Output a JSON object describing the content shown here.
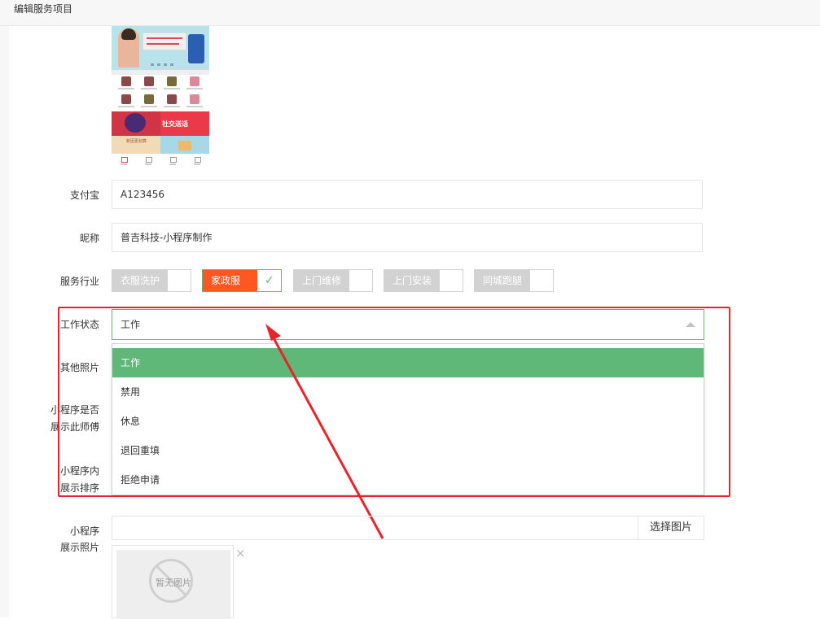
{
  "header": {
    "title": "编辑服务项目"
  },
  "preview": {
    "promo_text": "社交送话",
    "promo_sub": "新团更划算"
  },
  "form": {
    "alipay": {
      "label": "支付宝",
      "value": "A123456"
    },
    "nickname": {
      "label": "昵称",
      "value": "普吉科技-小程序制作"
    },
    "industry": {
      "label": "服务行业",
      "options": [
        {
          "label": "衣服洗护",
          "checked": false
        },
        {
          "label": "家政服务",
          "checked": true
        },
        {
          "label": "上门维修",
          "checked": false
        },
        {
          "label": "上门安装",
          "checked": false
        },
        {
          "label": "同城跑腿",
          "checked": false
        }
      ]
    },
    "work_status": {
      "label": "工作状态",
      "selected": "工作",
      "options": [
        "工作",
        "禁用",
        "休息",
        "退回重填",
        "拒绝申请"
      ]
    },
    "other_photos": {
      "label": "其他照片"
    },
    "show_in_app": {
      "label_line1": "小程序是否",
      "label_line2": "展示此师傅"
    },
    "sort_order": {
      "label_line1": "小程序内",
      "label_line2": "展示排序"
    },
    "display_photo": {
      "label_line1": "小程序",
      "label_line2": "展示照片",
      "button": "选择图片",
      "placeholder_text": "暂无图片",
      "remove_glyph": "×"
    }
  },
  "colors": {
    "accent": "#5fb878",
    "checked_chip": "#ff5722",
    "annotation": "#e8232a"
  }
}
